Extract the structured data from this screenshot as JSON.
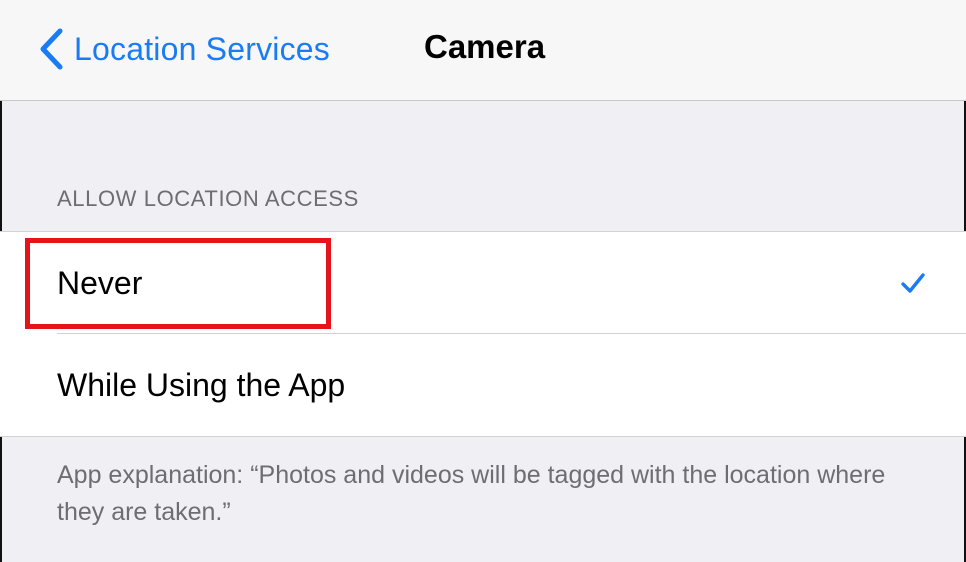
{
  "navbar": {
    "back_label": "Location Services",
    "title": "Camera"
  },
  "section": {
    "header": "ALLOW LOCATION ACCESS"
  },
  "options": [
    {
      "label": "Never",
      "selected": true
    },
    {
      "label": "While Using the App",
      "selected": false
    }
  ],
  "footer": {
    "text": "App explanation: “Photos and videos will be tagged with the location where they are taken.”"
  },
  "colors": {
    "accent": "#1a7cf5",
    "highlight_box": "#e5141a",
    "grouped_background": "#efeff4",
    "secondary_text": "#6d6d72"
  },
  "icons": {
    "back": "chevron-left-icon",
    "selected": "checkmark-icon"
  }
}
